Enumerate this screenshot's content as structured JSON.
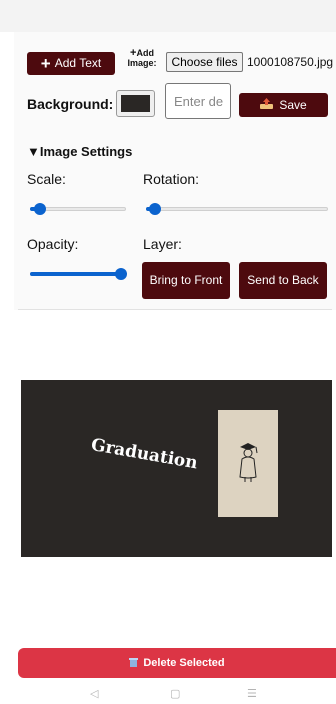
{
  "toolbar": {
    "add_text_label": "Add Text",
    "add_image_label_line1": "Add",
    "add_image_label_line2": "Image:",
    "choose_files_label": "Choose files",
    "file_name": "1000108750.jpg"
  },
  "background": {
    "label": "Background:",
    "color": "#2a2725",
    "text_input_placeholder": "Enter de",
    "save_label": "Save"
  },
  "settings": {
    "summary_label": "Image Settings",
    "scale_label": "Scale:",
    "rotation_label": "Rotation:",
    "opacity_label": "Opacity:",
    "layer_label": "Layer:",
    "scale_level": 0.1,
    "rotation_level": 0.05,
    "opacity_level": 0.95,
    "bring_front_label": "Bring to Front",
    "send_back_label": "Send to Back"
  },
  "canvas": {
    "text": "Graduation",
    "background_color": "#2a2725"
  },
  "actions": {
    "delete_label": "Delete Selected"
  },
  "colors": {
    "accent": "#4d0a0e",
    "slider": "#0b63ce",
    "danger": "#dc3545"
  },
  "icons": {
    "add_text": "plus-icon",
    "add_image": "plus-icon",
    "save": "upload-icon",
    "delete": "trash-icon",
    "nav_back": "back-triangle-icon",
    "nav_home": "home-square-icon",
    "nav_menu": "menu-lines-icon"
  }
}
